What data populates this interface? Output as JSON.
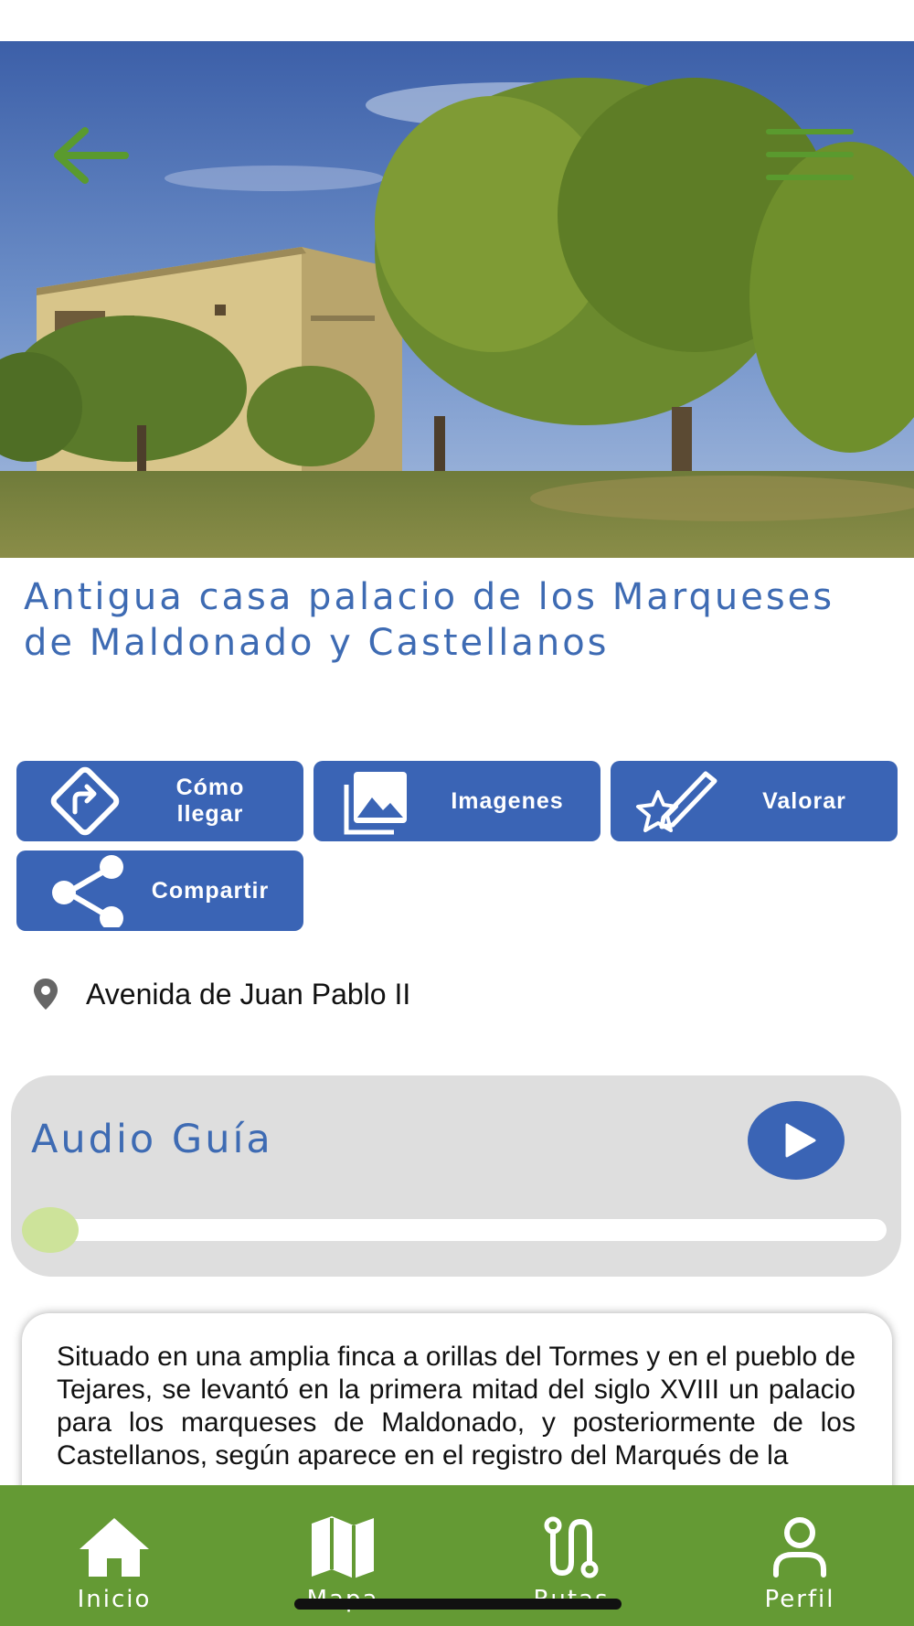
{
  "header": {
    "back_icon": "arrow-left-icon",
    "menu_icon": "hamburger-menu-icon",
    "accent_color": "#5a9a2e"
  },
  "place": {
    "title": "Antigua casa palacio de los Marqueses de Maldonado y Castellanos",
    "address": "Avenida de Juan Pablo II",
    "description": "Situado en una amplia finca a orillas del Tormes y en el pueblo de Tejares, se levantó en la primera mitad del siglo XVIII un palacio para los marqueses de Maldonado, y posteriormente de los Castellanos, según aparece en el registro del Marqués de la"
  },
  "actions": [
    {
      "label": "Cómo llegar",
      "icon": "directions-icon"
    },
    {
      "label": "Imagenes",
      "icon": "images-icon"
    },
    {
      "label": "Valorar",
      "icon": "rate-star-pen-icon"
    },
    {
      "label": "Compartir",
      "icon": "share-icon"
    }
  ],
  "audio": {
    "title": "Audio Guía",
    "progress": 0
  },
  "nav": [
    {
      "label": "Inicio",
      "icon": "home-icon"
    },
    {
      "label": "Mapa",
      "icon": "map-icon"
    },
    {
      "label": "Rutas",
      "icon": "route-icon"
    },
    {
      "label": "Perfil",
      "icon": "user-icon"
    }
  ],
  "colors": {
    "primary_blue": "#3a64b5",
    "title_blue": "#3e6bb3",
    "nav_green": "#649a34",
    "slider_thumb": "#cde39a"
  }
}
